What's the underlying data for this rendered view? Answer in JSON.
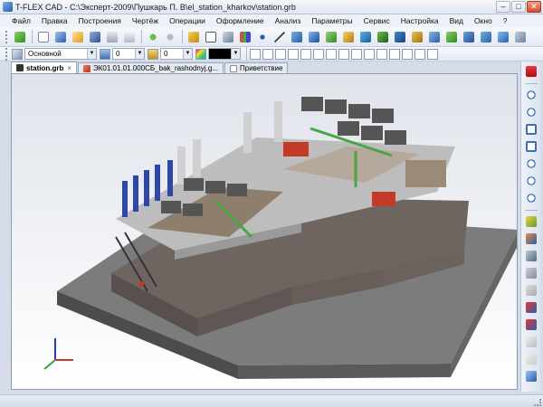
{
  "window": {
    "title": "T-FLEX CAD - C:\\Эксперт-2009\\Пушкарь П. В\\el_station_kharkov\\station.grb",
    "controls": [
      "–",
      "□",
      "✕"
    ]
  },
  "menu": [
    "Файл",
    "Правка",
    "Построения",
    "Чертёж",
    "Операции",
    "Оформление",
    "Анализ",
    "Параметры",
    "Сервис",
    "Настройка",
    "Вид",
    "Окно",
    "?"
  ],
  "toolbar2": {
    "layer": "Основной",
    "level_value": "0",
    "level_value_2": "0",
    "color_swatch": "#000000"
  },
  "tabs": [
    {
      "label": "station.grb",
      "active": true
    },
    {
      "label": "ЭК01.01.01.000СБ_bak_rashodnyj.g..."
    },
    {
      "label": "Приветствие"
    }
  ],
  "toolbar_icons": [
    "check-icon",
    "new-doc-icon",
    "cube-icon",
    "open-icon",
    "save-icon",
    "print-icon",
    "print-preview-icon",
    "undo-icon",
    "redo-icon",
    "eraser-icon",
    "zoom-window-icon",
    "plane-icon",
    "axis-icon",
    "point-icon",
    "line-icon",
    "spline-icon",
    "extrude-icon",
    "rotate-icon",
    "loft-icon",
    "pipe-icon",
    "boolean-icon",
    "fillet-icon",
    "chamfer-icon",
    "shell-icon",
    "array-icon",
    "mirror-icon",
    "section-icon",
    "surface-icon",
    "measure-icon"
  ],
  "side_icons": [
    "magnet-icon",
    "zoom-in-icon",
    "zoom-out-icon",
    "zoom-all-icon",
    "zoom-fit-icon",
    "zoom-window-icon",
    "zoom-prev-icon",
    "pan-icon",
    "select-icon",
    "filter-icon",
    "grid-icon",
    "snap-icon",
    "hide-icon",
    "check-icon",
    "render-icon",
    "light-icon",
    "material-icon",
    "view-cube-icon"
  ],
  "colors": {
    "accent": "#2a5fa8",
    "model_gray": "#6b6b6b",
    "model_red": "#c43a26",
    "model_green": "#4aa546",
    "model_blue": "#2e47a8"
  }
}
